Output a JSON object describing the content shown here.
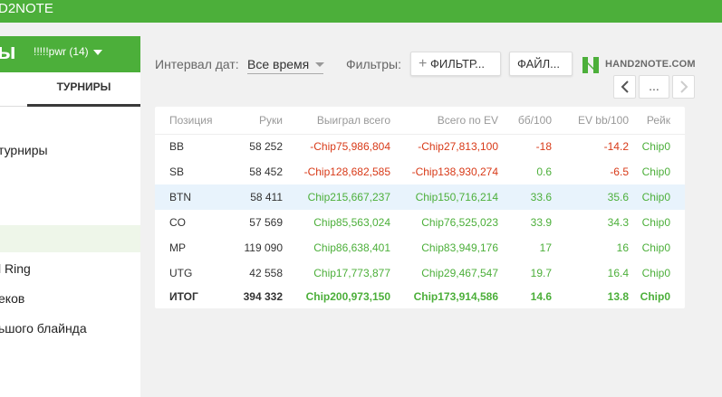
{
  "app": {
    "title": "D2NOTE"
  },
  "header": {
    "page_title": "ы",
    "player": "!!!!!pwr (14)"
  },
  "sidebar": {
    "tab_active": "ТУРНИРЫ",
    "items": [
      {
        "label": "турниры"
      },
      {
        "label": "l Ring"
      },
      {
        "label": "еков"
      },
      {
        "label": "ьшого блайнда"
      }
    ]
  },
  "filters": {
    "interval_label": "Интервал дат:",
    "interval_value": "Все время",
    "filters_label": "Фильтры:",
    "filter_button": "ФИЛЬТР...",
    "file_button": "ФАЙЛ...",
    "logo_text": "HAND2NOTE.COM",
    "nav_ellipsis": "..."
  },
  "table": {
    "columns": [
      "Позиция",
      "Руки",
      "Выиграл всего",
      "Всего по EV",
      "бб/100",
      "EV bb/100",
      "Рейк"
    ],
    "rows": [
      {
        "pos": "BB",
        "hands": "58 252",
        "won": "-Chip75,986,804",
        "ev": "-Chip27,813,100",
        "bb": "-18",
        "evbb": "-14.2",
        "rake": "Chip0",
        "won_c": "red",
        "ev_c": "red",
        "bb_c": "red",
        "evbb_c": "red"
      },
      {
        "pos": "SB",
        "hands": "58 452",
        "won": "-Chip128,682,585",
        "ev": "-Chip138,930,274",
        "bb": "0.6",
        "evbb": "-6.5",
        "rake": "Chip0",
        "won_c": "red",
        "ev_c": "red",
        "bb_c": "green",
        "evbb_c": "red"
      },
      {
        "pos": "BTN",
        "hands": "58 411",
        "won": "Chip215,667,237",
        "ev": "Chip150,716,214",
        "bb": "33.6",
        "evbb": "35.6",
        "rake": "Chip0",
        "won_c": "green",
        "ev_c": "green",
        "bb_c": "green",
        "evbb_c": "green"
      },
      {
        "pos": "CO",
        "hands": "57 569",
        "won": "Chip85,563,024",
        "ev": "Chip76,525,023",
        "bb": "33.9",
        "evbb": "34.3",
        "rake": "Chip0",
        "won_c": "green",
        "ev_c": "green",
        "bb_c": "green",
        "evbb_c": "green"
      },
      {
        "pos": "MP",
        "hands": "119 090",
        "won": "Chip86,638,401",
        "ev": "Chip83,949,176",
        "bb": "17",
        "evbb": "16",
        "rake": "Chip0",
        "won_c": "green",
        "ev_c": "green",
        "bb_c": "green",
        "evbb_c": "green"
      },
      {
        "pos": "UTG",
        "hands": "42 558",
        "won": "Chip17,773,877",
        "ev": "Chip29,467,547",
        "bb": "19.7",
        "evbb": "16.4",
        "rake": "Chip0",
        "won_c": "green",
        "ev_c": "green",
        "bb_c": "green",
        "evbb_c": "green"
      }
    ],
    "total": {
      "pos": "ИТОГ",
      "hands": "394 332",
      "won": "Chip200,973,150",
      "ev": "Chip173,914,586",
      "bb": "14.6",
      "evbb": "13.8",
      "rake": "Chip0"
    }
  },
  "colors": {
    "brand_green": "#4caf3a",
    "negative_red": "#d83a18",
    "highlight_row": "#e8f3fc"
  }
}
